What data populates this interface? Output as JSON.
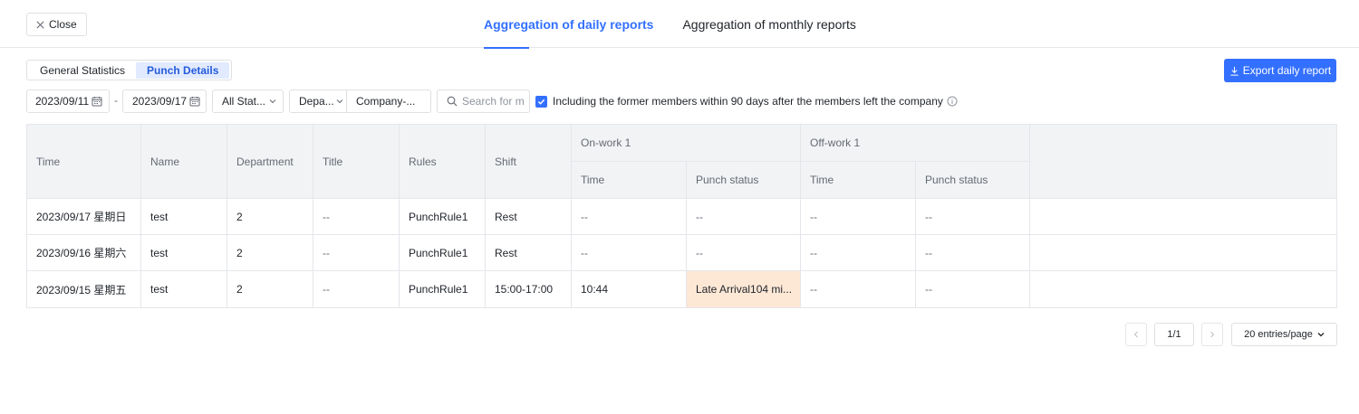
{
  "header": {
    "close_label": "Close",
    "tabs": [
      {
        "label": "Aggregation of daily reports",
        "active": true
      },
      {
        "label": "Aggregation of monthly reports",
        "active": false
      }
    ]
  },
  "view_switch": {
    "options": [
      "General Statistics",
      "Punch Details"
    ],
    "selected": "Punch Details"
  },
  "export_label": "Export daily report",
  "filters": {
    "start_date": "2023/09/11",
    "date_separator": "-",
    "end_date": "2023/09/17",
    "status": "All Stat...",
    "department": "Depa...",
    "company": "Company-...",
    "search_placeholder": "Search for m",
    "include_former_label": "Including the former members within 90 days after the members left the company",
    "include_former_checked": true
  },
  "table": {
    "headers": {
      "time": "Time",
      "name": "Name",
      "department": "Department",
      "title": "Title",
      "rules": "Rules",
      "shift": "Shift",
      "on_work_group": "On-work 1",
      "off_work_group": "Off-work 1",
      "sub_time": "Time",
      "sub_status": "Punch status"
    },
    "rows": [
      {
        "time": "2023/09/17 星期日",
        "name": "test",
        "department": "2",
        "title": "--",
        "rules": "PunchRule1",
        "shift": "Rest",
        "on_time": "--",
        "on_status": "--",
        "off_time": "--",
        "off_status": "--"
      },
      {
        "time": "2023/09/16 星期六",
        "name": "test",
        "department": "2",
        "title": "--",
        "rules": "PunchRule1",
        "shift": "Rest",
        "on_time": "--",
        "on_status": "--",
        "off_time": "--",
        "off_status": "--"
      },
      {
        "time": "2023/09/15 星期五",
        "name": "test",
        "department": "2",
        "title": "--",
        "rules": "PunchRule1",
        "shift": "15:00-17:00",
        "on_time": "10:44",
        "on_status": "Late Arrival104 mi...",
        "off_time": "--",
        "off_status": "--"
      }
    ]
  },
  "pagination": {
    "page": "1/1",
    "page_size": "20 entries/page"
  },
  "colors": {
    "accent": "#3370ff",
    "late_highlight": "#fde8d6",
    "header_bg": "#f2f3f5"
  }
}
